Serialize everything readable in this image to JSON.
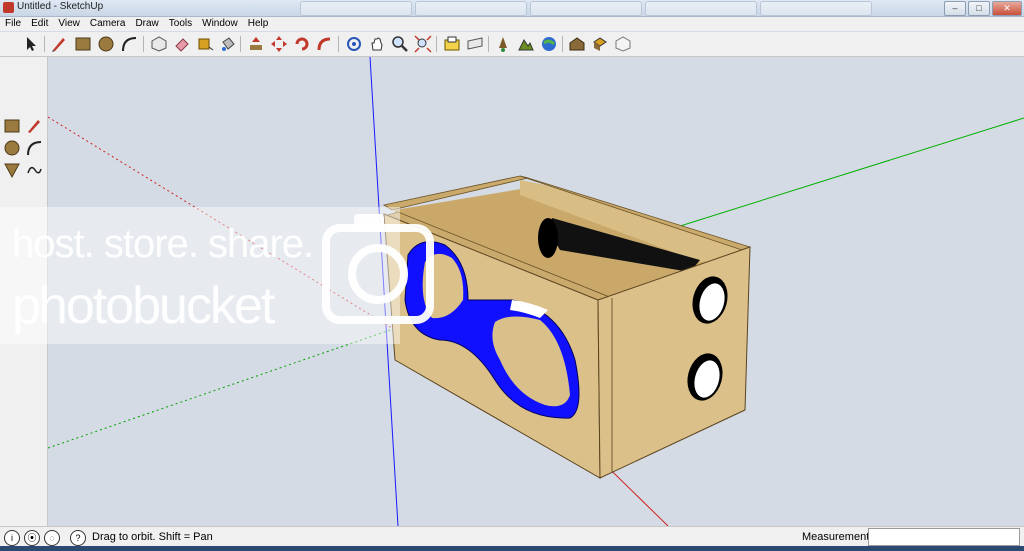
{
  "window": {
    "title": "Untitled - SketchUp"
  },
  "menu": [
    "File",
    "Edit",
    "View",
    "Camera",
    "Draw",
    "Tools",
    "Window",
    "Help"
  ],
  "status": {
    "hint": "Drag to orbit.  Shift = Pan",
    "measurements_label": "Measurements",
    "measurements_value": ""
  },
  "watermark": {
    "line1": "host. store. share.",
    "line2": "photobucket"
  },
  "colors": {
    "viewport_bg": "#d4dbe4",
    "wood": "#dcc089",
    "blue_axis": "#1a1aff",
    "green_axis": "#00b000",
    "red_axis": "#d02020",
    "port_blue": "#1010ff"
  },
  "icons": {
    "toolbar": [
      "select-icon",
      "pencil-icon",
      "rectangle-icon",
      "circle-icon",
      "arc-icon",
      "make-component-icon",
      "eraser-icon",
      "tape-measure-icon",
      "paint-bucket-icon",
      "push-pull-icon",
      "move-icon",
      "rotate-icon",
      "follow-me-icon",
      "orbit-icon",
      "pan-icon",
      "zoom-icon",
      "zoom-extents-icon",
      "get-models-icon",
      "share-model-icon",
      "geolocation-icon",
      "toggle-terrain-icon",
      "google-earth-icon",
      "warehouse-icon",
      "components-icon",
      "extension-icon"
    ]
  }
}
